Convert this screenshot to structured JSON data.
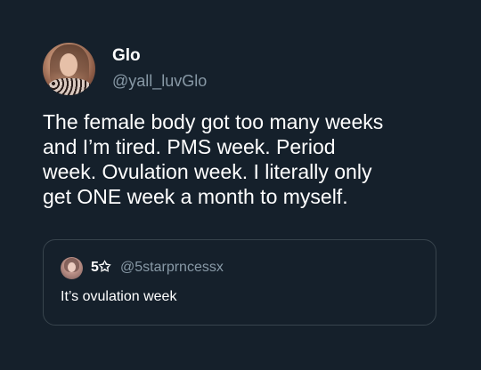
{
  "tweet": {
    "author": {
      "display_name": "Glo",
      "handle": "@yall_luvGlo",
      "avatar": "profile-photo"
    },
    "text_lines": [
      "The female body got too many weeks",
      "and I’m tired. PMS week. Period",
      "week. Ovulation week. I literally only",
      "get ONE week a month to myself."
    ]
  },
  "quoted_tweet": {
    "author": {
      "display_name": "5✩",
      "handle": "@5starprncessx",
      "avatar": "profile-photo"
    },
    "text": "It’s ovulation week"
  },
  "colors": {
    "background": "#15202b",
    "text_primary": "#ffffff",
    "text_secondary": "#8899a6",
    "border": "#38444d"
  }
}
